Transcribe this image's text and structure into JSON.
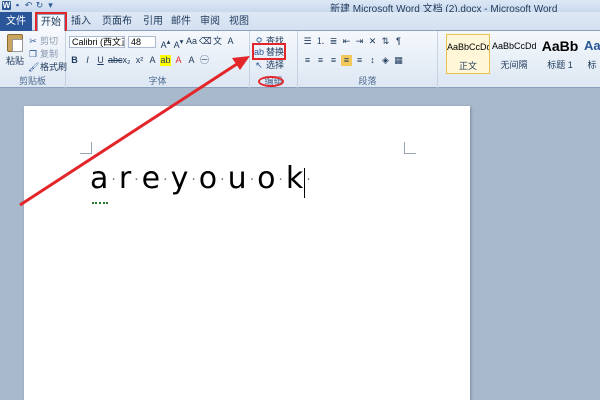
{
  "titlebar": {
    "title": "新建 Microsoft Word 文档 (2).docx - Microsoft Word"
  },
  "tabs": [
    {
      "label": "文件"
    },
    {
      "label": "开始"
    },
    {
      "label": "插入"
    },
    {
      "label": "页面布局"
    },
    {
      "label": "引用"
    },
    {
      "label": "邮件"
    },
    {
      "label": "审阅"
    },
    {
      "label": "视图"
    }
  ],
  "clipboard": {
    "paste": "粘贴",
    "cut": "剪切",
    "copy": "复制",
    "format_painter": "格式刷",
    "label": "剪贴板"
  },
  "font": {
    "name": "Calibri (西文正",
    "size": "48",
    "label": "字体"
  },
  "paragraph": {
    "label": "段落"
  },
  "editing": {
    "find": "查找",
    "replace": "替换",
    "select": "选择",
    "label": "编辑"
  },
  "styles": [
    {
      "sample": "AaBbCcDd",
      "name": "正文"
    },
    {
      "sample": "AaBbCcDd",
      "name": "无间隔"
    },
    {
      "sample": "AaBb",
      "name": "标题 1"
    },
    {
      "sample": "Aa",
      "name": "标"
    }
  ],
  "document": {
    "letters": [
      "a",
      "r",
      "e",
      "y",
      "o",
      "u",
      "o",
      "k"
    ]
  },
  "colors": {
    "annotation": "#e3262a",
    "file_tab": "#2a5699"
  }
}
